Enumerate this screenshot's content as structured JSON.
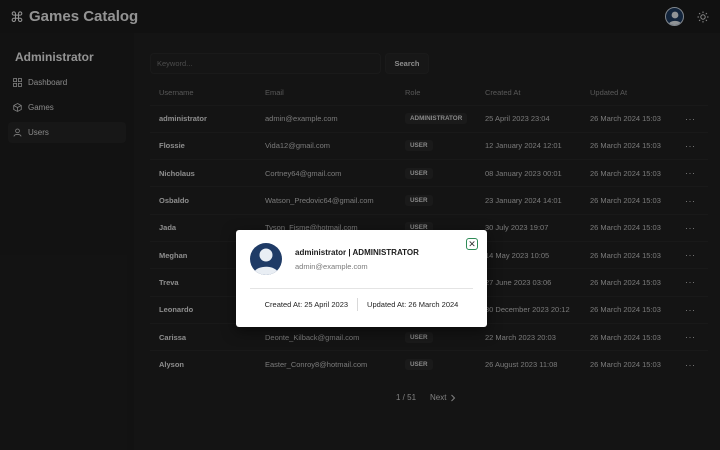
{
  "app": {
    "title": "Games Catalog",
    "logo_icon": "command-icon"
  },
  "header": {
    "avatar_icon": "user-avatar-icon",
    "theme_icon": "sun-icon"
  },
  "sidebar": {
    "title": "Administrator",
    "items": [
      {
        "label": "Dashboard",
        "icon": "grid-icon",
        "active": false
      },
      {
        "label": "Games",
        "icon": "cube-icon",
        "active": false
      },
      {
        "label": "Users",
        "icon": "user-icon",
        "active": true
      }
    ]
  },
  "search": {
    "placeholder": "Keyword...",
    "value": "",
    "button_label": "Search"
  },
  "table": {
    "columns": [
      "Username",
      "Email",
      "Role",
      "Created At",
      "Updated At"
    ],
    "rows": [
      {
        "username": "administrator",
        "email": "admin@example.com",
        "role": "ADMINISTRATOR",
        "created": "25 April 2023 23:04",
        "updated": "26 March 2024 15:03"
      },
      {
        "username": "Flossie",
        "email": "Vida12@gmail.com",
        "role": "USER",
        "created": "12 January 2024 12:01",
        "updated": "26 March 2024 15:03"
      },
      {
        "username": "Nicholaus",
        "email": "Cortney64@gmail.com",
        "role": "USER",
        "created": "08 January 2023 00:01",
        "updated": "26 March 2024 15:03"
      },
      {
        "username": "Osbaldo",
        "email": "Watson_Predovic64@gmail.com",
        "role": "USER",
        "created": "23 January 2024 14:01",
        "updated": "26 March 2024 15:03"
      },
      {
        "username": "Jada",
        "email": "Tyson_Fisme@hotmail.com",
        "role": "USER",
        "created": "30 July 2023 19:07",
        "updated": "26 March 2024 15:03"
      },
      {
        "username": "Meghan",
        "email": "",
        "role": "USER",
        "created": "14 May 2023 10:05",
        "updated": "26 March 2024 15:03"
      },
      {
        "username": "Treva",
        "email": "",
        "role": "USER",
        "created": "27 June 2023 03:06",
        "updated": "26 March 2024 15:03"
      },
      {
        "username": "Leonardo",
        "email": "",
        "role": "USER",
        "created": "30 December 2023 20:12",
        "updated": "26 March 2024 15:03"
      },
      {
        "username": "Carissa",
        "email": "Deonte_Kilback@gmail.com",
        "role": "USER",
        "created": "22 March 2023 20:03",
        "updated": "26 March 2024 15:03"
      },
      {
        "username": "Alyson",
        "email": "Easter_Conroy8@hotmail.com",
        "role": "USER",
        "created": "26 August 2023 11:08",
        "updated": "26 March 2024 15:03"
      }
    ],
    "row_menu": "···"
  },
  "pagination": {
    "page_text": "1 / 51",
    "next_label": "Next",
    "next_icon": "chevron-right-icon"
  },
  "modal": {
    "name": "administrator | ADMINISTRATOR",
    "email": "admin@example.com",
    "created": "Created At: 25 April 2023",
    "updated": "Updated At: 26 March 2024",
    "close_icon": "close-icon",
    "avatar_icon": "user-avatar-icon"
  },
  "colors": {
    "background": "#1c1c1c",
    "panel": "#212121",
    "modal": "#ffffff",
    "close_border": "#2e8b57",
    "avatar": "#1f3b66"
  }
}
